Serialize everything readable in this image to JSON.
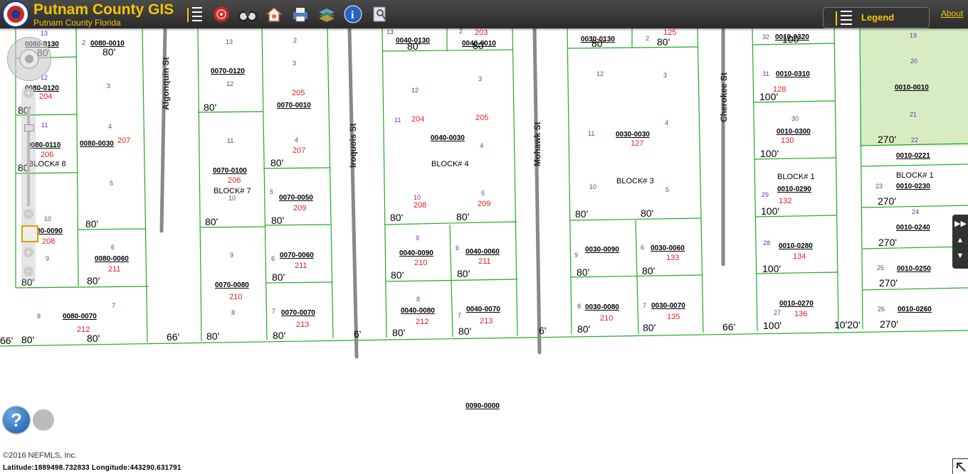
{
  "header": {
    "title": "Putnam County GIS",
    "subtitle": "Putnam County Florida",
    "legend_label": "Legend",
    "about_label": "About"
  },
  "toolbar": {
    "tools": [
      "layers-list-icon",
      "target-icon",
      "binoculars-icon",
      "home-icon",
      "print-icon",
      "layers-icon",
      "info-icon",
      "identify-icon"
    ]
  },
  "map": {
    "streets": [
      "Algonquin St",
      "Iroquois St",
      "Mohawk St",
      "Cherokee St"
    ],
    "blocks": [
      "BLOCK# 8",
      "BLOCK# 7",
      "BLOCK# 4",
      "BLOCK# 3",
      "BLOCK# 1",
      "BLOCK# 1"
    ],
    "parcels": [
      "0080-0130",
      "0080-0010",
      "0080-0120",
      "0080-0110",
      "0080-0030",
      "0080-0090",
      "0080-0060",
      "0080-0070",
      "0070-0120",
      "0070-0010",
      "0070-0100",
      "0070-0050",
      "0070-0060",
      "0070-0080",
      "0070-0070",
      "0040-0130",
      "0040-0010",
      "0040-0030",
      "0040-0090",
      "0040-0060",
      "0040-0080",
      "0040-0070",
      "0030-0130",
      "0030-0030",
      "0030-0090",
      "0030-0060",
      "0030-0080",
      "0030-0070",
      "0010-0320",
      "0010-0310",
      "0010-0300",
      "0010-0290",
      "0010-0280",
      "0010-0270",
      "0010-0010",
      "0010-0221",
      "0010-0230",
      "0010-0240",
      "0010-0250",
      "0010-0260",
      "0090-0000"
    ]
  },
  "footer": {
    "copyright": "©2016 NEFMLS, Inc.",
    "coords": "Latitude:1889498.732833   Longitude:443290.631791"
  },
  "colors": {
    "accent": "#f5c400",
    "parcel_line": "#22aa22",
    "header_bg": "#333333",
    "park": "#d8ecc4"
  }
}
